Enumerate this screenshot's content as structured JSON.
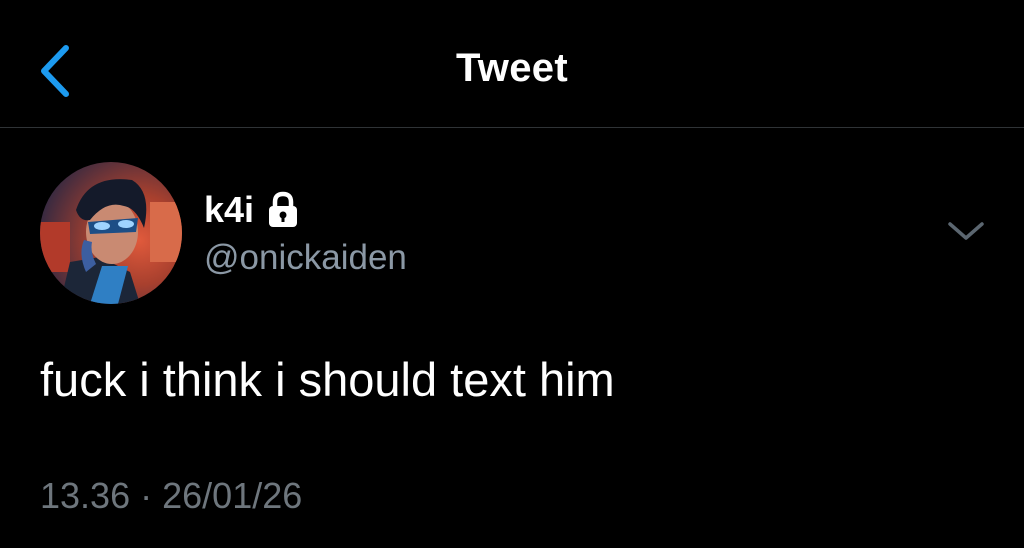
{
  "header": {
    "back_icon": "chevron-left-icon",
    "title": "Tweet"
  },
  "tweet": {
    "author": {
      "display_name": "k4i",
      "handle": "@onickaiden",
      "protected_icon": "lock-icon",
      "avatar": "avatar-image"
    },
    "more_icon": "chevron-down-icon",
    "text": "fuck i think i should text him",
    "time": "13.36",
    "separator": "·",
    "date": "26/01/26"
  },
  "colors": {
    "background": "#000000",
    "accent": "#1d9bf0",
    "secondary_text": "#8b98a5",
    "meta_text": "#6e767d",
    "divider": "#2f3336"
  }
}
